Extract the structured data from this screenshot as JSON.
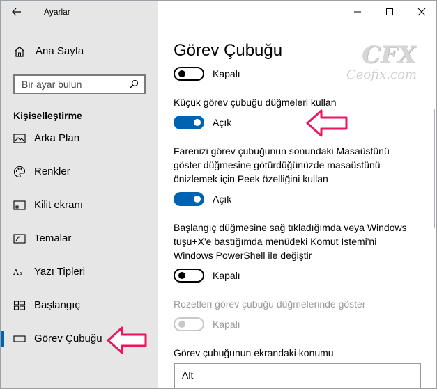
{
  "window": {
    "title": "Ayarlar"
  },
  "sidebar": {
    "home_label": "Ana Sayfa",
    "search_placeholder": "Bir ayar bulun",
    "section_title": "Kişiselleştirme",
    "items": [
      {
        "label": "Arka Plan",
        "icon": "picture-icon"
      },
      {
        "label": "Renkler",
        "icon": "palette-icon"
      },
      {
        "label": "Kilit ekranı",
        "icon": "lock-screen-icon"
      },
      {
        "label": "Temalar",
        "icon": "themes-icon"
      },
      {
        "label": "Yazı Tipleri",
        "icon": "fonts-icon"
      },
      {
        "label": "Başlangıç",
        "icon": "start-icon"
      },
      {
        "label": "Görev Çubuğu",
        "icon": "taskbar-icon",
        "selected": true
      }
    ]
  },
  "main": {
    "title": "Görev Çubuğu",
    "settings": [
      {
        "description": "",
        "state_label": "Kapalı",
        "on": false,
        "disabled": false
      },
      {
        "description": "Küçük görev çubuğu düğmeleri kullan",
        "state_label": "Açık",
        "on": true,
        "disabled": false
      },
      {
        "description": "Farenizi görev çubuğunun sonundaki Masaüstünü göster düğmesine götürdüğünüzde masaüstünü önizlemek için Peek özelliğini kullan",
        "state_label": "Açık",
        "on": true,
        "disabled": false
      },
      {
        "description": "Başlangıç düğmesine sağ tıkladığımda veya Windows tuşu+X'e bastığımda menüdeki Komut İstemi'ni Windows PowerShell ile değiştir",
        "state_label": "Kapalı",
        "on": false,
        "disabled": false
      },
      {
        "description": "Rozetleri görev çubuğu düğmelerinde göster",
        "state_label": "Kapalı",
        "on": false,
        "disabled": true
      }
    ],
    "position_label": "Görev çubuğunun ekrandaki konumu",
    "position_value": "Alt"
  },
  "watermark": {
    "logo": "CFX",
    "text": "Ceofix.com"
  },
  "colors": {
    "accent": "#0063b1",
    "sidebar_bg": "#e6e6e6",
    "arrow": "#e8175d"
  }
}
